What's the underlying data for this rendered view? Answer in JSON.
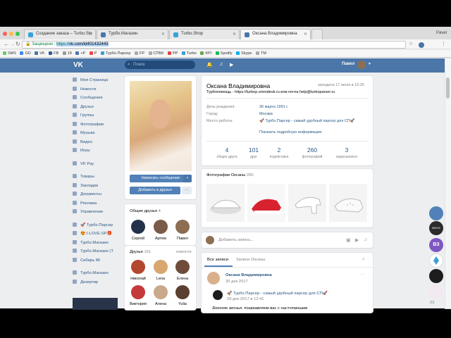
{
  "browser": {
    "tabs": [
      {
        "label": "Создание заказа – Turbo.Sto"
      },
      {
        "label": "Турбо.Магазин"
      },
      {
        "label": "Turbo.Shop"
      },
      {
        "label": "Оксана Владимировна"
      }
    ],
    "profile_name": "Pavel",
    "url_secure": "Защищено",
    "url_prefix": "https://",
    "url_host": "vk.com/id401432443",
    "bookmarks": [
      "SMS",
      "GD",
      "VK",
      "FB",
      "18",
      "+P",
      "P",
      "Турбо.Парсер",
      "FP",
      "СПБК",
      "PP",
      "Turbo",
      "KPI",
      "Spotify",
      "Skype",
      "TM"
    ]
  },
  "header": {
    "logo": "VK",
    "search_placeholder": "Поиск",
    "user_name": "Павел"
  },
  "left_nav": {
    "main": [
      "Моя Страница",
      "Новости",
      "Сообщения",
      "Друзья",
      "Группы",
      "Фотографии",
      "Музыка",
      "Видео",
      "Игры"
    ],
    "pay": "VK Pay",
    "services": [
      "Товары",
      "Закладки",
      "Документы",
      "Реклама",
      "Управление"
    ],
    "groups": [
      "🚀 Турбо.Парсер",
      "😍 I-LOVE-SP🎁",
      "Турбо.Магазин",
      "Турбо.Магазин (Т",
      "Сибирь 86"
    ],
    "extra": [
      "Турбо.Магазин",
      "Дезертир"
    ]
  },
  "profile": {
    "send_message": "Написать сообщение",
    "add_friend": "Добавить в друзья",
    "common_friends_title": "Общие друзья",
    "common_friends_count": "4",
    "common_friends": [
      "Сергей",
      "Артем",
      "Павел"
    ],
    "friends_title": "Друзья",
    "friends_count": "101",
    "friends_link": "новости",
    "friends": [
      "Николай",
      "Lena",
      "Елена",
      "Виктория",
      "Алена",
      "Yulia"
    ],
    "name": "Оксана Владимировна",
    "last_seen": "заходила 17 июля в 10:26",
    "status": "Турбопомощь - https://turbop.omnidesk.ru или почта help@turboparser.ru",
    "info": [
      {
        "key": "День рождения:",
        "value": "30 марта 1991 г."
      },
      {
        "key": "Город:",
        "value": "Москва"
      },
      {
        "key": "Место работы:",
        "value": "🚀 Турбо.Парсер - самый удобный парсер для СП🚀"
      }
    ],
    "show_more": "Показать подробную информацию",
    "counters": [
      {
        "n": "4",
        "l": "общих друга"
      },
      {
        "n": "101",
        "l": "друг"
      },
      {
        "n": "2",
        "l": "подписчика"
      },
      {
        "n": "260",
        "l": "фотографий"
      },
      {
        "n": "3",
        "l": "видеозаписи"
      }
    ],
    "photos_title": "Фотографии Оксаны",
    "photos_count": "260",
    "add_post": "Добавить запись...",
    "wall_tabs": [
      "Все записи",
      "Записи Оксаны"
    ],
    "post": {
      "author": "Оксана Владимировна",
      "date": "30 дек 2017",
      "repost_author": "🚀 Турбо.Парсер - самый удобный парсер для СП🚀",
      "repost_date": "29 дек 2017 в 12:41",
      "text": "Дорогие друзья, поздравляем вас с наступающим"
    }
  },
  "right_widgets": {
    "label": "МНОХ",
    "badge1": "ВЗ",
    "count": "22"
  }
}
